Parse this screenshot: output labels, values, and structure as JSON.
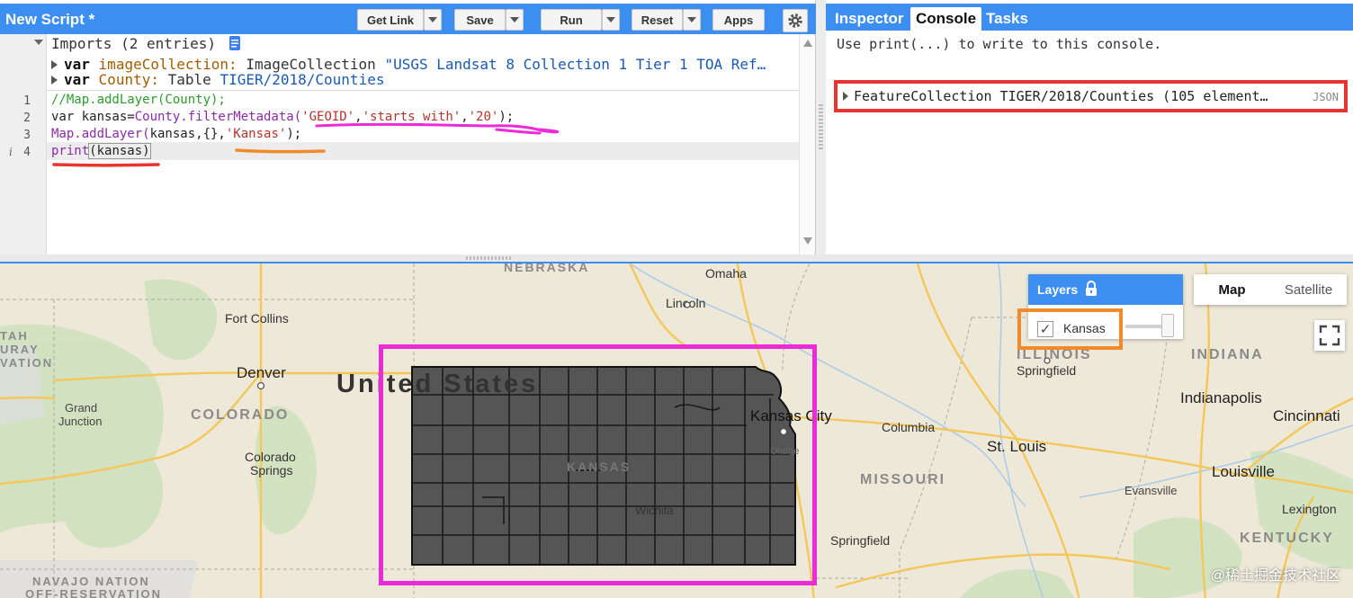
{
  "editor": {
    "script_title": "New Script *",
    "buttons": {
      "get_link": "Get Link",
      "save": "Save",
      "run": "Run",
      "reset": "Reset",
      "apps": "Apps"
    },
    "imports_header": "Imports (2 entries)",
    "imports": [
      {
        "kw": "var",
        "name": "imageCollection:",
        "type": "ImageCollection",
        "value": "\"USGS Landsat 8 Collection 1 Tier 1 TOA Ref…"
      },
      {
        "kw": "var",
        "name": "County:",
        "type": "Table",
        "value": "TIGER/2018/Counties"
      }
    ],
    "line_numbers": [
      "1",
      "2",
      "3",
      "4"
    ],
    "code": {
      "l1": "//Map.addLayer(County);",
      "l2_a": "var kansas=",
      "l2_b": "County.filterMetadata(",
      "l2_c": "'GEOID'",
      "l2_d": ",",
      "l2_e": "'starts_with'",
      "l2_f": ",",
      "l2_g": "'20'",
      "l2_h": ");",
      "l3_a": "Map.addLayer(",
      "l3_b": "kansas,{},",
      "l3_c": "'Kansas'",
      "l3_d": ");",
      "l4_a": "print",
      "l4_b": "(kansas)"
    }
  },
  "right_panel": {
    "tabs": [
      "Inspector",
      "Console",
      "Tasks"
    ],
    "active_tab": "Console",
    "console_hint": "Use print(...) to write to this console.",
    "result_text": "FeatureCollection TIGER/2018/Counties (105 element…",
    "result_badge": "JSON"
  },
  "map": {
    "layers_title": "Layers",
    "layer_name": "Kansas",
    "layer_checked": true,
    "map_type": {
      "map": "Map",
      "satellite": "Satellite",
      "selected": "Map"
    },
    "labels": {
      "nebraska": "NEBRASKA",
      "omaha": "Omaha",
      "lincoln": "Lincoln",
      "fort_collins": "Fort Collins",
      "utah_1": "TAH",
      "utah_2": "URAY",
      "utah_3": "VATION",
      "denver": "Denver",
      "united_states": "United States",
      "grand_junction_1": "Grand",
      "grand_junction_2": "Junction",
      "colorado": "COLORADO",
      "colorado_springs_1": "Colorado",
      "colorado_springs_2": "Springs",
      "kansas_state": "KANSAS",
      "kansas_city": "Kansas City",
      "wichita": "Wichita",
      "olathe": "Olathe",
      "columbia": "Columbia",
      "illinois": "ILLINOIS",
      "springfield_il": "Springfield",
      "indiana": "INDIANA",
      "indianapolis": "Indianapolis",
      "cincinnati": "Cincinnati",
      "st_louis": "St. Louis",
      "missouri": "MISSOURI",
      "louisville": "Louisville",
      "evansville": "Evansville",
      "lexington": "Lexington",
      "kentucky": "KENTUCKY",
      "springfield_mo": "Springfield",
      "navajo_1": "NAVAJO NATION",
      "navajo_2": "OFF-RESERVATION"
    },
    "watermark": "@稀土掘金技术社区"
  },
  "colors": {
    "header_blue": "#3c8ef0",
    "kansas_fill": "#555555",
    "highlight_magenta": "#ec2bd8",
    "highlight_red": "#e8332e",
    "highlight_orange": "#f08a2a"
  }
}
